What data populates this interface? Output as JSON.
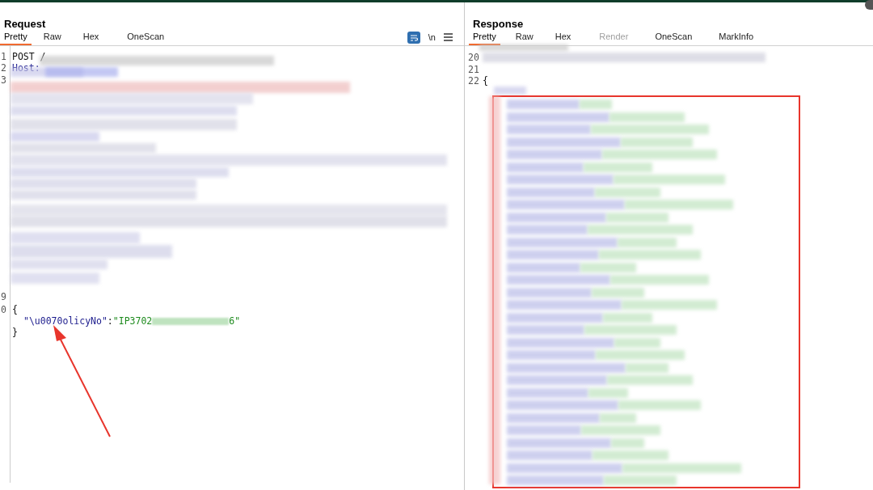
{
  "request": {
    "title": "Request",
    "tabs": [
      {
        "label": "Pretty",
        "selected": true
      },
      {
        "label": "Raw",
        "selected": false
      },
      {
        "label": "Hex",
        "selected": false
      },
      {
        "label": "OneScan",
        "selected": false
      }
    ],
    "toolbar": {
      "newline_toggle": "\\n"
    },
    "lines": [
      {
        "number": "1",
        "kind": "text",
        "text": "POST /"
      },
      {
        "number": "2",
        "kind": "header",
        "text": "Host:"
      },
      {
        "number": "3",
        "kind": "blank"
      },
      {
        "number": "9",
        "kind": "blank"
      },
      {
        "number": "0",
        "kind": "text",
        "text": "{"
      },
      {
        "kind": "pair",
        "key": "\"\\u0070olicyNo\"",
        "separator": ":",
        "value_start": "\"IP3702",
        "value_end": "6\""
      },
      {
        "kind": "text",
        "text": "}"
      }
    ]
  },
  "response": {
    "title": "Response",
    "tabs": [
      {
        "label": "Pretty",
        "selected": true,
        "disabled": false
      },
      {
        "label": "Raw",
        "selected": false,
        "disabled": false
      },
      {
        "label": "Hex",
        "selected": false,
        "disabled": false
      },
      {
        "label": "Render",
        "selected": false,
        "disabled": true
      },
      {
        "label": "OneScan",
        "selected": false,
        "disabled": false
      },
      {
        "label": "MarkInfo",
        "selected": false,
        "disabled": false
      }
    ],
    "lines": [
      {
        "number": "20"
      },
      {
        "number": "21"
      },
      {
        "number": "22",
        "text": "{"
      }
    ]
  }
}
